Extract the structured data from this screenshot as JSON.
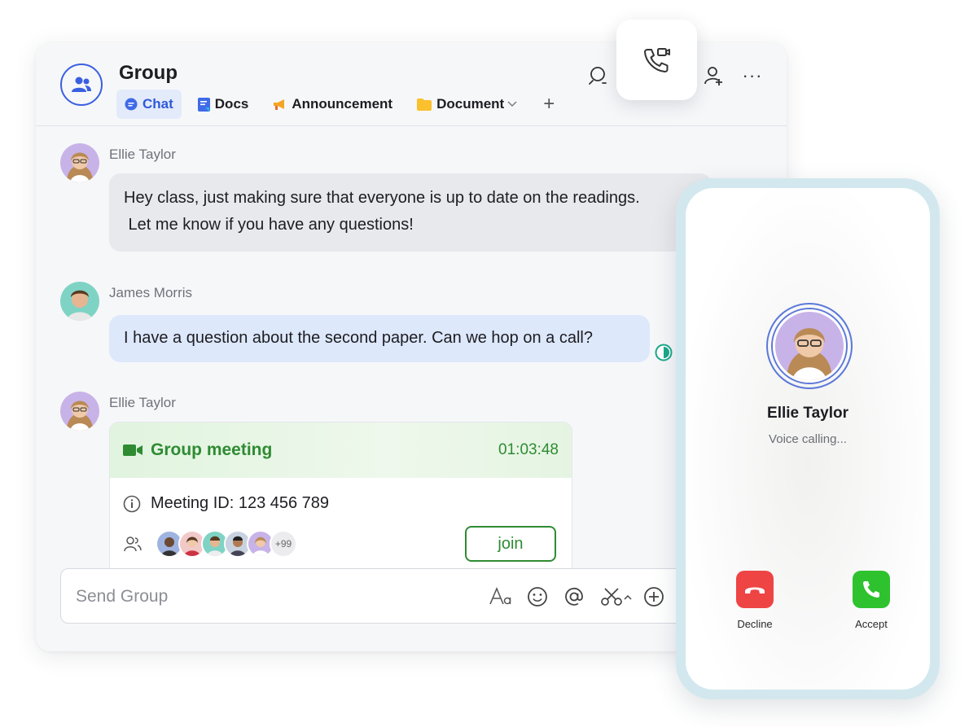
{
  "group": {
    "title": "Group",
    "tabs": [
      {
        "label": "Chat",
        "active": true
      },
      {
        "label": "Docs"
      },
      {
        "label": "Announcement"
      },
      {
        "label": "Document"
      }
    ],
    "add_tab_label": "+",
    "more_label": "···"
  },
  "messages": [
    {
      "sender": "Ellie Taylor",
      "line1": "Hey class, just making sure that everyone is up to date on the readings.",
      "line2": " Let me know if you have any questions!"
    },
    {
      "sender": "James Morris",
      "text": "I have a question about the second paper. Can we hop on a call?"
    },
    {
      "sender": "Ellie Taylor"
    }
  ],
  "meeting": {
    "title": "Group meeting",
    "timer": "01:03:48",
    "meeting_id": "Meeting ID: 123 456 789",
    "more_participants": "+99",
    "join_label": "join"
  },
  "composer": {
    "placeholder": "Send Group",
    "icons": [
      "text-format-icon",
      "emoji-icon",
      "mention-icon",
      "scissors-icon",
      "plus-circle-icon"
    ]
  },
  "incoming_call": {
    "caller": "Ellie Taylor",
    "status": "Voice calling...",
    "decline_label": "Decline",
    "accept_label": "Accept"
  },
  "colors": {
    "accent": "#2f59d9",
    "green": "#2e8b32",
    "decline": "#ee4444",
    "accept": "#2ec22e"
  }
}
